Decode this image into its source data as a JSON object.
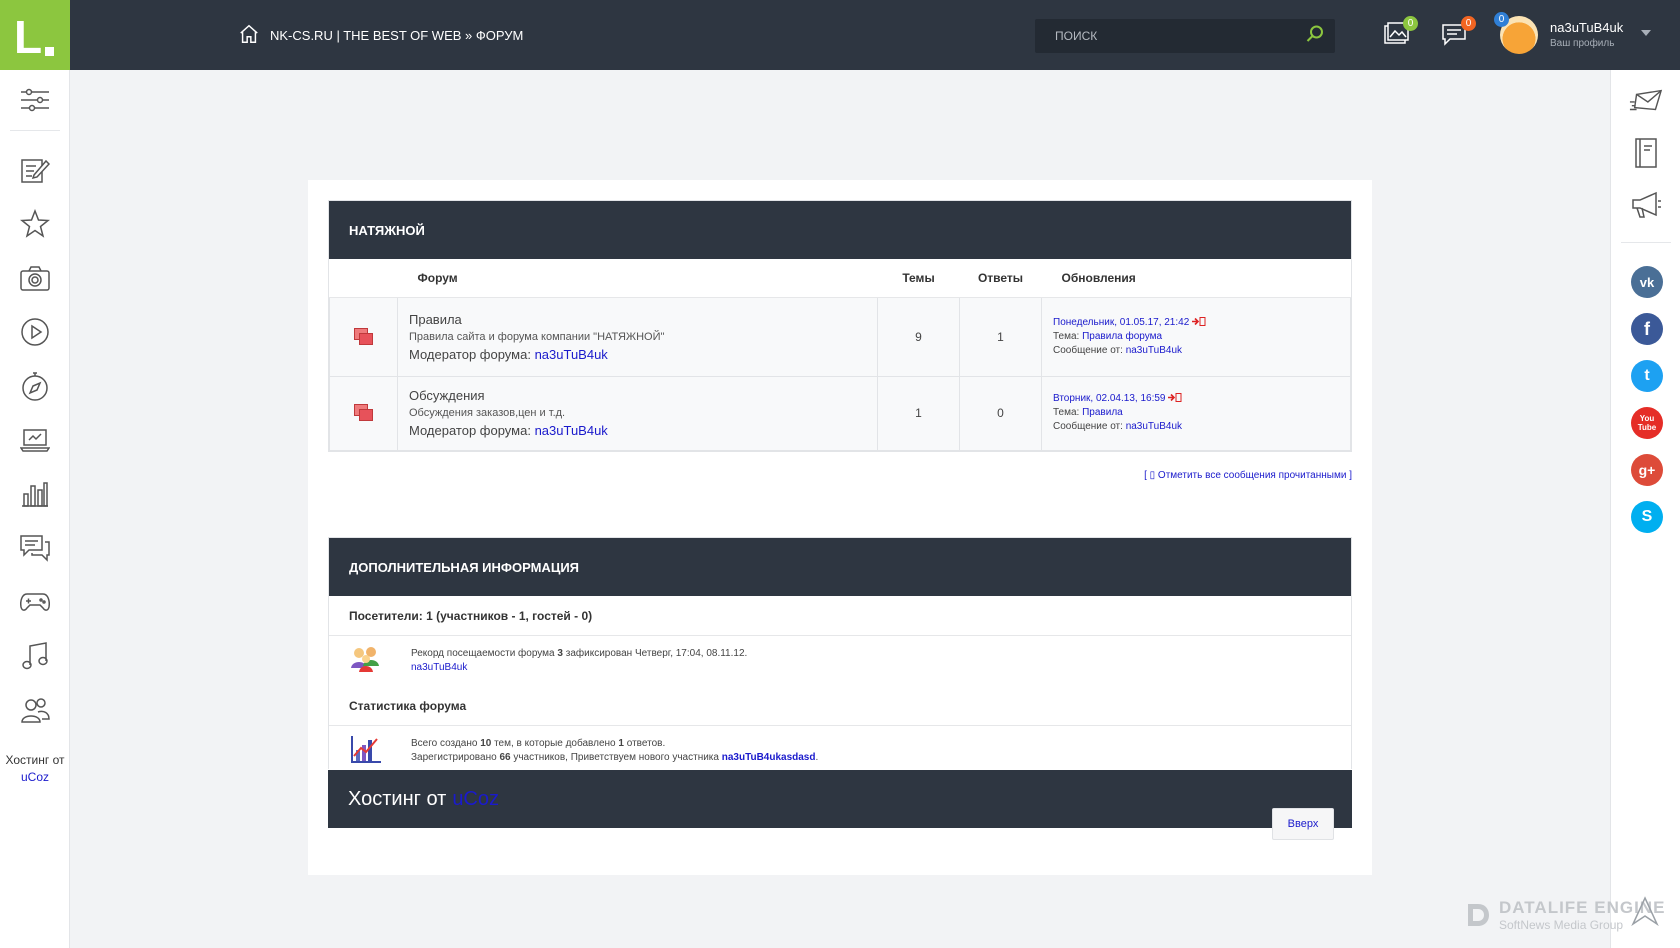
{
  "logo": {
    "letter": "L"
  },
  "breadcrumb": {
    "text": "NK-CS.RU | THE BEST OF WEB » ФОРУМ"
  },
  "search": {
    "placeholder": "ПОИСК"
  },
  "notifications": {
    "gallery_count": "0",
    "messages_count": "0",
    "profile_count": "0"
  },
  "profile": {
    "name": "na3uTuB4uk",
    "subtitle": "Ваш профиль"
  },
  "sidebar": {
    "items": [
      "settings-sliders-icon",
      "edit-note-icon",
      "star-icon",
      "camera-icon",
      "play-icon",
      "compass-icon",
      "laptop-icon",
      "bar-chart-icon",
      "chat-icon",
      "gamepad-icon",
      "music-note-icon",
      "users-icon"
    ],
    "hosting_text": "Хостинг от",
    "hosting_link": "uCoz"
  },
  "rightbar": {
    "items": [
      "mail-send-icon",
      "notebook-icon",
      "megaphone-icon"
    ],
    "social": [
      {
        "name": "vk-icon",
        "glyph": "vk",
        "color": "#4a6f96"
      },
      {
        "name": "facebook-icon",
        "glyph": "f",
        "color": "#3b5998"
      },
      {
        "name": "twitter-icon",
        "glyph": "t",
        "color": "#1da1f2"
      },
      {
        "name": "youtube-icon",
        "glyph": "You Tube",
        "color": "#e52d27"
      },
      {
        "name": "google-plus-icon",
        "glyph": "g+",
        "color": "#dd4b39"
      },
      {
        "name": "skype-icon",
        "glyph": "S",
        "color": "#00aff0"
      }
    ]
  },
  "forum": {
    "category_title": "НАТЯЖНОЙ",
    "columns": {
      "forum": "Форум",
      "topics": "Темы",
      "replies": "Ответы",
      "updates": "Обновления"
    },
    "rows": [
      {
        "name": "Правила",
        "description": "Правила сайта и форума компании \"НАТЯЖНОЙ\"",
        "moderator_label": "Модератор форума:",
        "moderator": "na3uTuB4uk",
        "topics": "9",
        "replies": "1",
        "last_date": "Понедельник, 01.05.17, 21:42",
        "topic_label": "Тема:",
        "topic": "Правила форума",
        "author_label": "Сообщение от:",
        "author": "na3uTuB4uk"
      },
      {
        "name": "Обсуждения",
        "description": "Обсуждения заказов,цен и т.д.",
        "moderator_label": "Модератор форума:",
        "moderator": "na3uTuB4uk",
        "topics": "1",
        "replies": "0",
        "last_date": "Вторник, 02.04.13, 16:59",
        "topic_label": "Тема:",
        "topic": "Правила",
        "author_label": "Сообщение от:",
        "author": "na3uTuB4uk"
      }
    ],
    "mark_all_read": "[ ▯ Отметить все сообщения прочитанными ]"
  },
  "info": {
    "title": "ДОПОЛНИТЕЛЬНАЯ ИНФОРМАЦИЯ",
    "visitors_title": "Посетители: 1  (участников - 1, гостей - 0)",
    "record_pre": "Рекорд посещаемости форума",
    "record_count": "3",
    "record_post": "зафиксирован Четверг, 17:04, 08.11.12.",
    "record_user": "na3uTuB4uk",
    "stats_title": "Статистика форума",
    "stats_pre": "Всего создано",
    "stats_topics": "10",
    "stats_mid": "тем, в которые добавлено",
    "stats_replies": "1",
    "stats_post": "ответов.",
    "reg_pre": "Зарегистрировано",
    "reg_count": "66",
    "reg_mid": "участников, Приветствуем нового участника",
    "reg_user": "na3uTuB4ukasdasd"
  },
  "footer": {
    "hosting_text": "Хостинг от",
    "hosting_link": "uCoz",
    "up_button": "Вверх"
  },
  "brand": {
    "title": "DATALIFE ENGINE",
    "subtitle": "SoftNews Media Group"
  }
}
